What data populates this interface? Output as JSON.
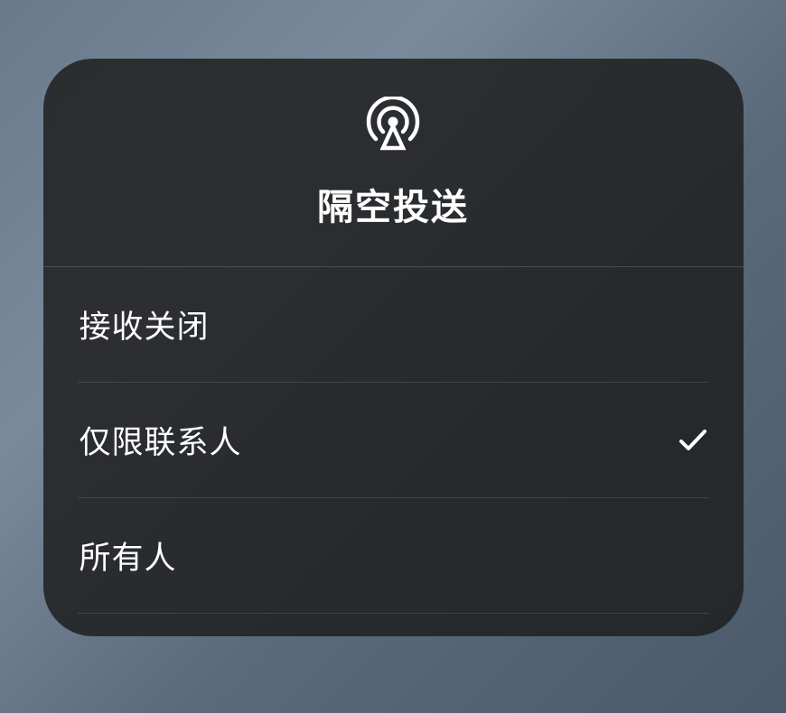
{
  "panel": {
    "title": "隔空投送",
    "icon": "airdrop-icon"
  },
  "options": [
    {
      "label": "接收关闭",
      "selected": false
    },
    {
      "label": "仅限联系人",
      "selected": true
    },
    {
      "label": "所有人",
      "selected": false
    }
  ]
}
